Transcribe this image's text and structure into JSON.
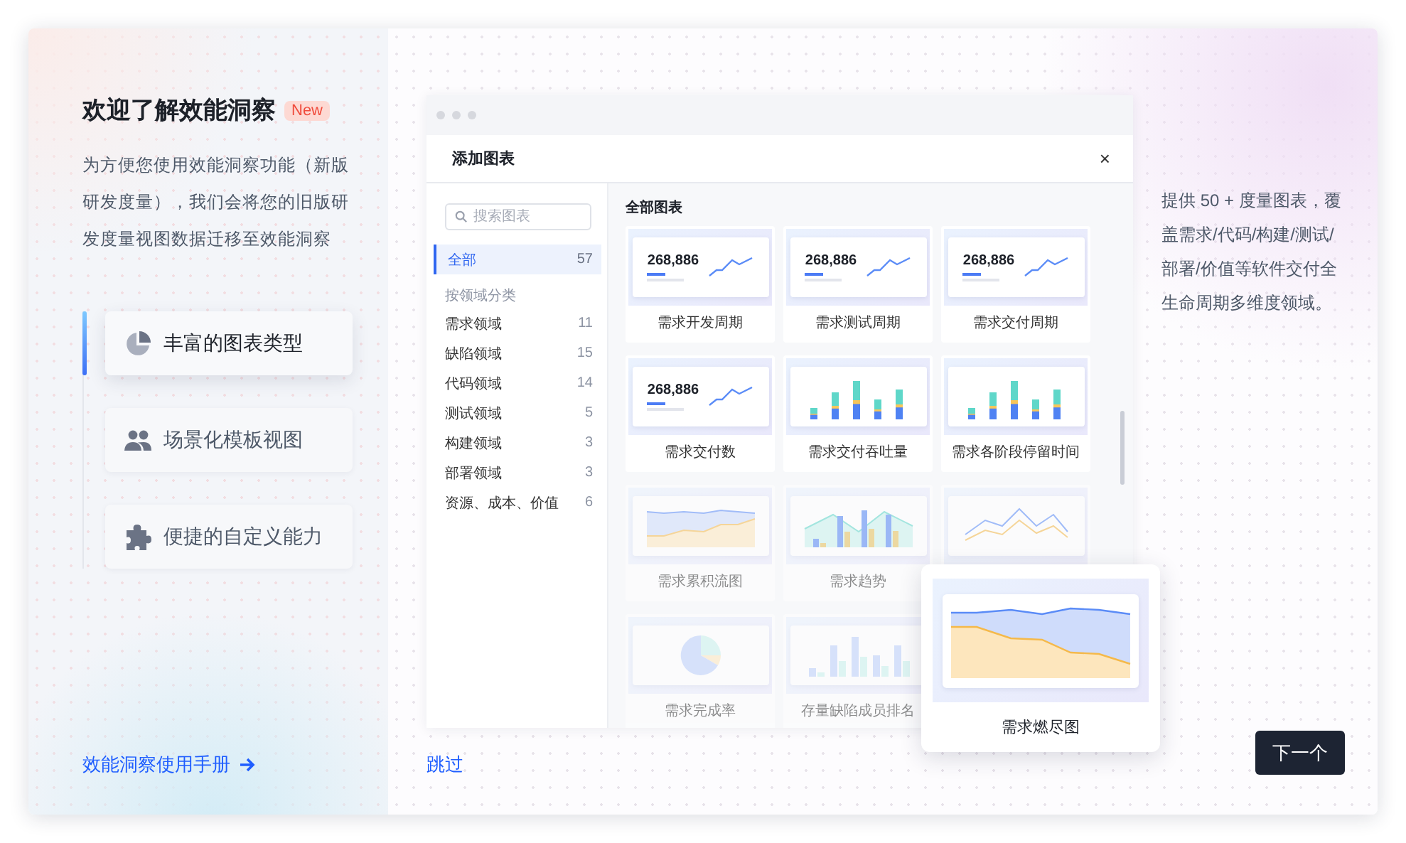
{
  "intro": {
    "title": "欢迎了解效能洞察",
    "badge": "New",
    "description": "为方便您使用效能洞察功能（新版研发度量），我们会将您的旧版研发度量视图数据迁移至效能洞察"
  },
  "features": [
    {
      "label": "丰富的图表类型",
      "kind": "pie",
      "selected": true
    },
    {
      "label": "场景化模板视图",
      "kind": "people",
      "selected": false
    },
    {
      "label": "便捷的自定义能力",
      "kind": "puzzle",
      "selected": false
    }
  ],
  "manual_link": "效能洞察使用手册",
  "dialog": {
    "title": "添加图表",
    "close": "×",
    "search": {
      "placeholder": "搜索图表"
    },
    "all_item": {
      "label": "全部",
      "count": "57",
      "selected": true
    },
    "group_label": "按领域分类",
    "domains": [
      {
        "label": "需求领域",
        "count": "11",
        "selected": false
      },
      {
        "label": "缺陷领域",
        "count": "15",
        "selected": false
      },
      {
        "label": "代码领域",
        "count": "14",
        "selected": false
      },
      {
        "label": "测试领域",
        "count": "5",
        "selected": false
      },
      {
        "label": "构建领域",
        "count": "3",
        "selected": false
      },
      {
        "label": "部署领域",
        "count": "3",
        "selected": false
      },
      {
        "label": "资源、成本、价值",
        "count": "6",
        "selected": false
      }
    ],
    "section_title": "全部图表",
    "cards": [
      {
        "kind": "kpi",
        "value": "268,886",
        "label": "需求开发周期",
        "dimmed": false
      },
      {
        "kind": "kpi",
        "value": "268,886",
        "label": "需求测试周期",
        "dimmed": false
      },
      {
        "kind": "kpi",
        "value": "268,886",
        "label": "需求交付周期",
        "dimmed": false
      },
      {
        "kind": "kpi",
        "value": "268,886",
        "label": "需求交付数",
        "dimmed": false
      },
      {
        "kind": "stacked-bar",
        "label": "需求交付吞吐量",
        "dimmed": false
      },
      {
        "kind": "stacked-bar",
        "label": "需求各阶段停留时间",
        "dimmed": false
      },
      {
        "kind": "area",
        "label": "需求累积流图",
        "dimmed": true
      },
      {
        "kind": "bar-line",
        "label": "需求趋势",
        "dimmed": true
      },
      {
        "kind": "line",
        "dimmed": true
      },
      {
        "kind": "pie",
        "label": "需求完成率",
        "dimmed": true
      },
      {
        "kind": "bar",
        "label": "存量缺陷成员排名",
        "dimmed": true
      }
    ]
  },
  "popup": {
    "kind": "area",
    "label": "需求燃尽图"
  },
  "description": "提供 50 + 度量图表，覆盖需求/代码/构建/测试/部署/价值等软件交付全生命周期多维度领域。",
  "skip": "跳过",
  "next": "下一个"
}
